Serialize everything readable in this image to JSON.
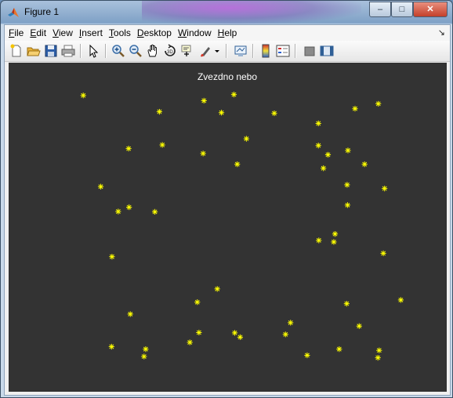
{
  "window": {
    "title": "Figure 1",
    "controls": {
      "minimize": "–",
      "maximize": "□",
      "close": "✕"
    }
  },
  "menu": [
    {
      "first": "F",
      "rest": "ile"
    },
    {
      "first": "E",
      "rest": "dit"
    },
    {
      "first": "V",
      "rest": "iew"
    },
    {
      "first": "I",
      "rest": "nsert"
    },
    {
      "first": "T",
      "rest": "ools"
    },
    {
      "first": "D",
      "rest": "esktop"
    },
    {
      "first": "W",
      "rest": "indow"
    },
    {
      "first": "H",
      "rest": "elp"
    }
  ],
  "toolbar": {
    "icons": [
      "new-figure-icon",
      "open-file-icon",
      "save-icon",
      "print-icon",
      "edit-plot-pointer-icon",
      "zoom-in-icon",
      "zoom-out-icon",
      "pan-hand-icon",
      "rotate-3d-icon",
      "data-cursor-icon",
      "brush-icon",
      "dropdown-arrow-icon",
      "link-plot-icon",
      "colorbar-icon",
      "legend-icon",
      "hide-plot-tools-icon",
      "show-plot-tools-icon"
    ]
  },
  "colors": {
    "plot_background": "#333333",
    "marker": "#ffff00",
    "title": "#ffffff"
  },
  "chart_data": {
    "type": "scatter",
    "title": "Zvezdno nebo",
    "xlabel": "",
    "ylabel": "",
    "marker": "*",
    "axes_visible": false,
    "grid": false,
    "xlim": [
      0,
      1
    ],
    "ylim": [
      0,
      1
    ],
    "points": [
      [
        0.153,
        0.929
      ],
      [
        0.443,
        0.912
      ],
      [
        0.515,
        0.932
      ],
      [
        0.336,
        0.876
      ],
      [
        0.485,
        0.873
      ],
      [
        0.612,
        0.871
      ],
      [
        0.718,
        0.838
      ],
      [
        0.806,
        0.886
      ],
      [
        0.862,
        0.902
      ],
      [
        0.343,
        0.768
      ],
      [
        0.262,
        0.756
      ],
      [
        0.545,
        0.788
      ],
      [
        0.441,
        0.74
      ],
      [
        0.523,
        0.705
      ],
      [
        0.718,
        0.766
      ],
      [
        0.741,
        0.736
      ],
      [
        0.789,
        0.75
      ],
      [
        0.73,
        0.692
      ],
      [
        0.829,
        0.705
      ],
      [
        0.195,
        0.632
      ],
      [
        0.787,
        0.638
      ],
      [
        0.877,
        0.626
      ],
      [
        0.263,
        0.565
      ],
      [
        0.237,
        0.551
      ],
      [
        0.325,
        0.55
      ],
      [
        0.788,
        0.572
      ],
      [
        0.758,
        0.478
      ],
      [
        0.719,
        0.457
      ],
      [
        0.755,
        0.452
      ],
      [
        0.222,
        0.404
      ],
      [
        0.874,
        0.415
      ],
      [
        0.475,
        0.299
      ],
      [
        0.427,
        0.256
      ],
      [
        0.916,
        0.263
      ],
      [
        0.786,
        0.251
      ],
      [
        0.266,
        0.217
      ],
      [
        0.651,
        0.189
      ],
      [
        0.816,
        0.178
      ],
      [
        0.431,
        0.157
      ],
      [
        0.517,
        0.156
      ],
      [
        0.53,
        0.142
      ],
      [
        0.639,
        0.151
      ],
      [
        0.221,
        0.111
      ],
      [
        0.303,
        0.103
      ],
      [
        0.409,
        0.125
      ],
      [
        0.768,
        0.103
      ],
      [
        0.864,
        0.099
      ],
      [
        0.299,
        0.079
      ],
      [
        0.691,
        0.083
      ],
      [
        0.861,
        0.075
      ]
    ]
  }
}
